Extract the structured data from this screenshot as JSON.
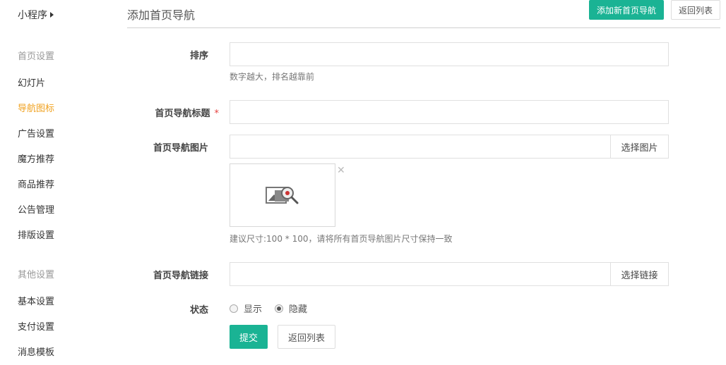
{
  "sidebar": {
    "top": "小程序",
    "groups": [
      {
        "title": "首页设置",
        "items": [
          "幻灯片",
          "导航图标",
          "广告设置",
          "魔方推荐",
          "商品推荐",
          "公告管理",
          "排版设置"
        ]
      },
      {
        "title": "其他设置",
        "items": [
          "基本设置",
          "支付设置",
          "消息模板"
        ]
      }
    ],
    "active": "导航图标"
  },
  "header": {
    "title": "添加首页导航",
    "add_label": "添加新首页导航",
    "back_label": "返回列表"
  },
  "form": {
    "sort": {
      "label": "排序",
      "value": "",
      "help": "数字越大，排名越靠前"
    },
    "nav_title": {
      "label": "首页导航标题",
      "required_mark": "*",
      "value": ""
    },
    "nav_image": {
      "label": "首页导航图片",
      "value": "",
      "button": "选择图片",
      "remove_mark": "✕",
      "help": "建议尺寸:100 * 100，请将所有首页导航图片尺寸保持一致"
    },
    "nav_link": {
      "label": "首页导航链接",
      "value": "",
      "button": "选择链接"
    },
    "status": {
      "label": "状态",
      "options": [
        "显示",
        "隐藏"
      ],
      "selected": "隐藏"
    },
    "submit_label": "提交",
    "back_label": "返回列表"
  },
  "colors": {
    "primary": "#1ab394",
    "active": "#f0a11f",
    "required": "#e64340"
  }
}
